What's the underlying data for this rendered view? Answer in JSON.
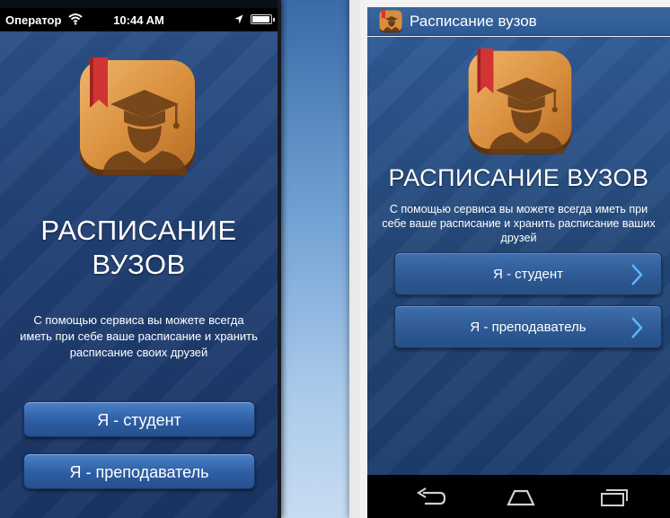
{
  "ios": {
    "status": {
      "carrier": "Оператор",
      "time": "10:44 AM"
    },
    "title": "РАСПИСАНИЕ ВУЗОВ",
    "description": "С помощью сервиса вы можете всегда иметь при себе ваше расписание и хранить расписание своих друзей",
    "buttons": {
      "student": "Я - студент",
      "teacher": "Я - преподаватель"
    }
  },
  "android": {
    "app_bar_title": "Расписание вузов",
    "title": "РАСПИСАНИЕ ВУЗОВ",
    "description": "С помощью сервиса вы можете всегда иметь при себе ваше расписание и хранить расписание ваших друзей",
    "buttons": {
      "student": "Я - студент",
      "teacher": "Я - преподаватель"
    }
  },
  "icons": {
    "app_logo": "graduate-cap-bookmark-icon",
    "wifi": "wifi-icon",
    "location": "location-arrow-icon",
    "battery": "battery-icon",
    "chevron": "chevron-right-icon",
    "nav_back": "back-icon",
    "nav_home": "home-icon",
    "nav_recent": "recent-apps-icon"
  },
  "colors": {
    "screen_blue": "#234777",
    "button_blue": "#2d5892",
    "logo_wood": "#d88f3d",
    "bookmark_red": "#d23434"
  }
}
